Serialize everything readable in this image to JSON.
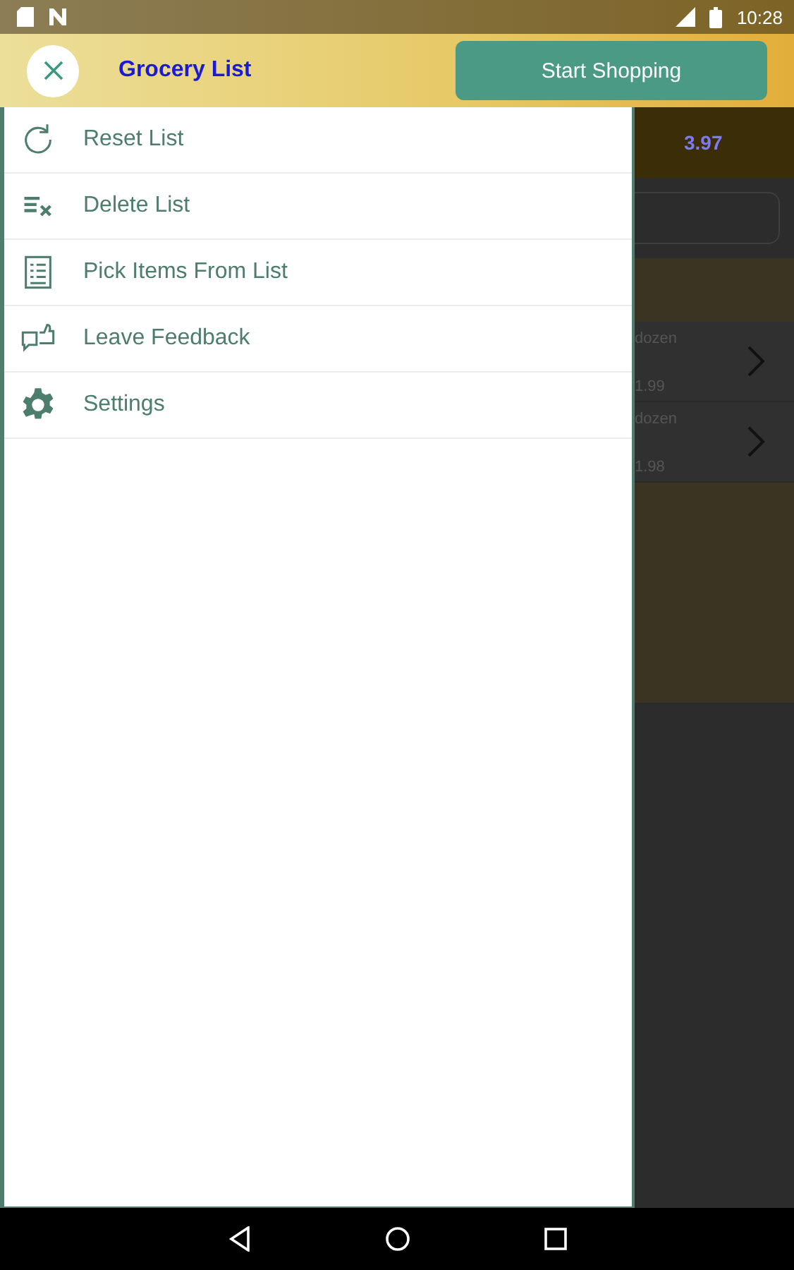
{
  "status_bar": {
    "time": "10:28"
  },
  "header": {
    "title": "Grocery List",
    "action": "Start Shopping"
  },
  "menu": [
    {
      "kind": "reset",
      "label": "Reset List"
    },
    {
      "kind": "delete",
      "label": "Delete List"
    },
    {
      "kind": "pick",
      "label": "Pick Items From List"
    },
    {
      "kind": "feedback",
      "label": "Leave Feedback"
    },
    {
      "kind": "settings",
      "label": "Settings"
    }
  ],
  "background": {
    "total": "3.97",
    "items": [
      {
        "unit": "dozen",
        "price": "1.99"
      },
      {
        "unit": "dozen",
        "price": "1.98"
      }
    ]
  }
}
